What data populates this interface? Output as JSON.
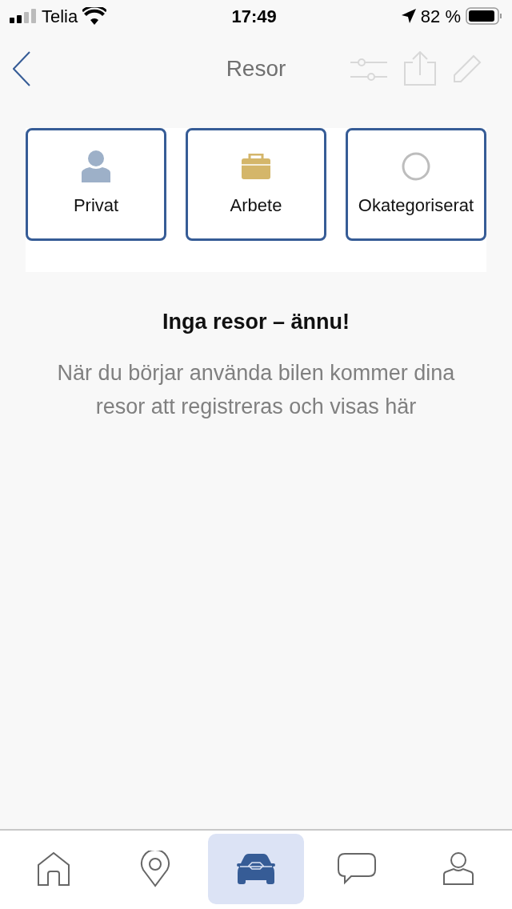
{
  "status_bar": {
    "carrier": "Telia",
    "time": "17:49",
    "battery": "82 %"
  },
  "nav": {
    "title": "Resor",
    "actions": [
      {
        "kind": "filter",
        "disabled": true
      },
      {
        "kind": "share",
        "disabled": true
      },
      {
        "kind": "edit",
        "disabled": true
      }
    ]
  },
  "categories": [
    {
      "kind": "person",
      "label": "Privat"
    },
    {
      "kind": "briefcase",
      "label": "Arbete"
    },
    {
      "kind": "circle",
      "label": "Okategoriserat"
    }
  ],
  "empty_state": {
    "title": "Inga resor – ännu!",
    "message": "När du börjar använda bilen kommer dina resor att registreras och visas här"
  },
  "tab_bar": [
    {
      "kind": "home",
      "selected": false
    },
    {
      "kind": "pin",
      "selected": false
    },
    {
      "kind": "car",
      "selected": true
    },
    {
      "kind": "chat",
      "selected": false
    },
    {
      "kind": "profile",
      "selected": false
    }
  ]
}
